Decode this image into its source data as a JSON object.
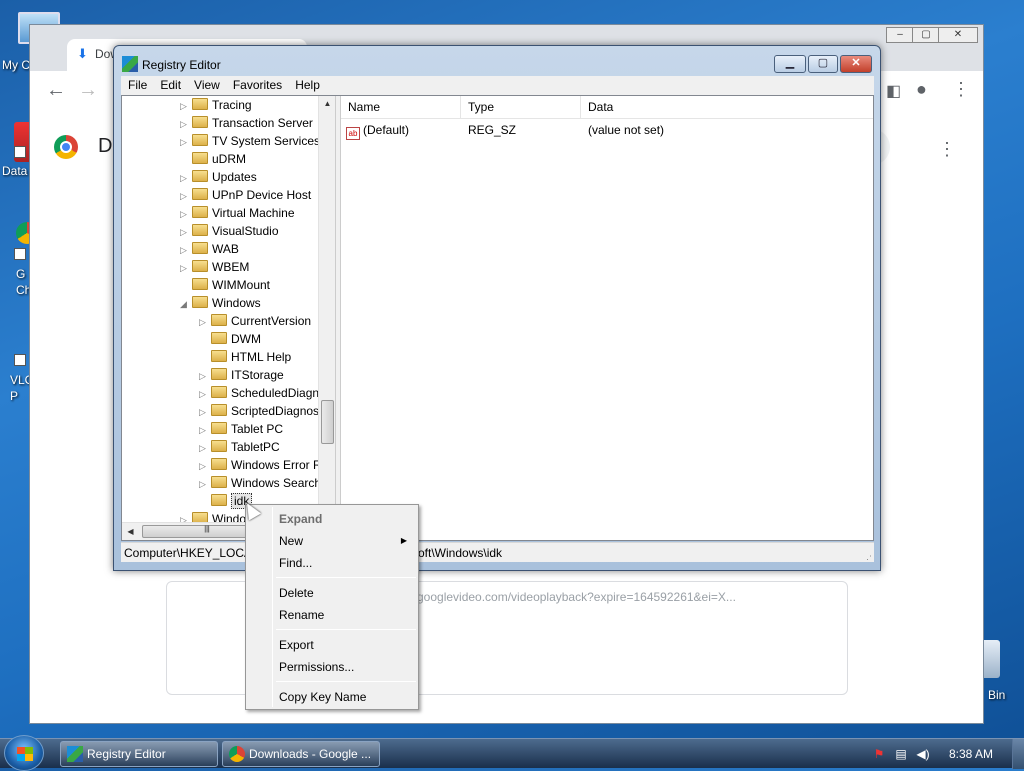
{
  "desktop": {
    "icons": [
      {
        "label": "My C"
      },
      {
        "label": "Data"
      },
      {
        "label": "G\nCh"
      },
      {
        "label": "VLC\nP"
      },
      {
        "label": "Bin"
      }
    ]
  },
  "chrome": {
    "tab_title": "Downlo",
    "page_title": "D",
    "download_url": "googlevideo.com/videoplayback?expire=164592261&ei=X..."
  },
  "regedit": {
    "title": "Registry Editor",
    "menu": [
      "File",
      "Edit",
      "View",
      "Favorites",
      "Help"
    ],
    "tree": [
      {
        "label": "Tracing",
        "depth": 1,
        "expander": "collapsed"
      },
      {
        "label": "Transaction Server",
        "depth": 1,
        "expander": "collapsed"
      },
      {
        "label": "TV System Services",
        "depth": 1,
        "expander": "collapsed"
      },
      {
        "label": "uDRM",
        "depth": 1,
        "expander": "none"
      },
      {
        "label": "Updates",
        "depth": 1,
        "expander": "collapsed"
      },
      {
        "label": "UPnP Device Host",
        "depth": 1,
        "expander": "collapsed"
      },
      {
        "label": "Virtual Machine",
        "depth": 1,
        "expander": "collapsed"
      },
      {
        "label": "VisualStudio",
        "depth": 1,
        "expander": "collapsed"
      },
      {
        "label": "WAB",
        "depth": 1,
        "expander": "collapsed"
      },
      {
        "label": "WBEM",
        "depth": 1,
        "expander": "collapsed"
      },
      {
        "label": "WIMMount",
        "depth": 1,
        "expander": "none"
      },
      {
        "label": "Windows",
        "depth": 1,
        "expander": "expanded"
      },
      {
        "label": "CurrentVersion",
        "depth": 2,
        "expander": "collapsed"
      },
      {
        "label": "DWM",
        "depth": 2,
        "expander": "none"
      },
      {
        "label": "HTML Help",
        "depth": 2,
        "expander": "none"
      },
      {
        "label": "ITStorage",
        "depth": 2,
        "expander": "collapsed"
      },
      {
        "label": "ScheduledDiagn",
        "depth": 2,
        "expander": "collapsed"
      },
      {
        "label": "ScriptedDiagnos",
        "depth": 2,
        "expander": "collapsed"
      },
      {
        "label": "Tablet PC",
        "depth": 2,
        "expander": "collapsed"
      },
      {
        "label": "TabletPC",
        "depth": 2,
        "expander": "collapsed"
      },
      {
        "label": "Windows Error R",
        "depth": 2,
        "expander": "collapsed"
      },
      {
        "label": "Windows Search",
        "depth": 2,
        "expander": "collapsed"
      },
      {
        "label": "idk",
        "depth": 2,
        "expander": "none",
        "selected": true
      },
      {
        "label": "Windo",
        "depth": 1,
        "expander": "collapsed"
      }
    ],
    "columns": [
      "Name",
      "Type",
      "Data"
    ],
    "values": [
      {
        "name": "(Default)",
        "type": "REG_SZ",
        "data": "(value not set)"
      }
    ],
    "status_left": "Computer\\HKEY_LOCA",
    "status_right": "oft\\Windows\\idk"
  },
  "context_menu": {
    "items": [
      {
        "label": "Expand",
        "disabled": true
      },
      {
        "label": "New",
        "submenu": true
      },
      {
        "label": "Find..."
      },
      {
        "separator": true
      },
      {
        "label": "Delete"
      },
      {
        "label": "Rename"
      },
      {
        "separator": true
      },
      {
        "label": "Export"
      },
      {
        "label": "Permissions..."
      },
      {
        "separator": true
      },
      {
        "label": "Copy Key Name"
      }
    ]
  },
  "taskbar": {
    "buttons": [
      {
        "label": "Registry Editor",
        "icon": "regedit-icon"
      },
      {
        "label": "Downloads - Google ...",
        "icon": "chrome-icon"
      }
    ],
    "clock": "8:38 AM"
  }
}
